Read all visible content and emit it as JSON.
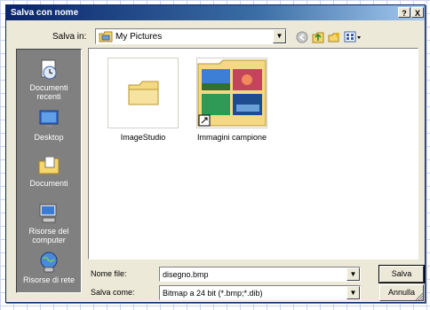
{
  "window": {
    "title": "Salva con nome"
  },
  "title_buttons": {
    "help": "?",
    "close": "X"
  },
  "look_in": {
    "label": "Salva in:",
    "value": "My Pictures",
    "icon": "folder-pictures-icon"
  },
  "toolbar": {
    "icons": [
      "back-icon",
      "up-one-level-icon",
      "new-folder-icon",
      "views-menu-icon"
    ]
  },
  "places": [
    {
      "label": "Documenti recenti",
      "icon": "recent-documents-icon"
    },
    {
      "label": "Desktop",
      "icon": "desktop-icon"
    },
    {
      "label": "Documenti",
      "icon": "my-documents-icon"
    },
    {
      "label": "Risorse del computer",
      "icon": "my-computer-icon"
    },
    {
      "label": "Risorse di rete",
      "icon": "network-places-icon"
    }
  ],
  "files": [
    {
      "name": "ImageStudio",
      "icon": "folder-icon"
    },
    {
      "name": "Immagini campione",
      "icon": "folder-shortcut-thumbnail-icon"
    }
  ],
  "file_name": {
    "label": "Nome file:",
    "value": "disegno.bmp"
  },
  "file_type": {
    "label": "Salva come:",
    "value": "Bitmap a 24 bit (*.bmp;*.dib)"
  },
  "buttons": {
    "save": "Salva",
    "cancel": "Annulla"
  },
  "colors": {
    "title_bar": "#0a246a",
    "dialog_face": "#ece9d8",
    "places_bar": "#808080"
  }
}
